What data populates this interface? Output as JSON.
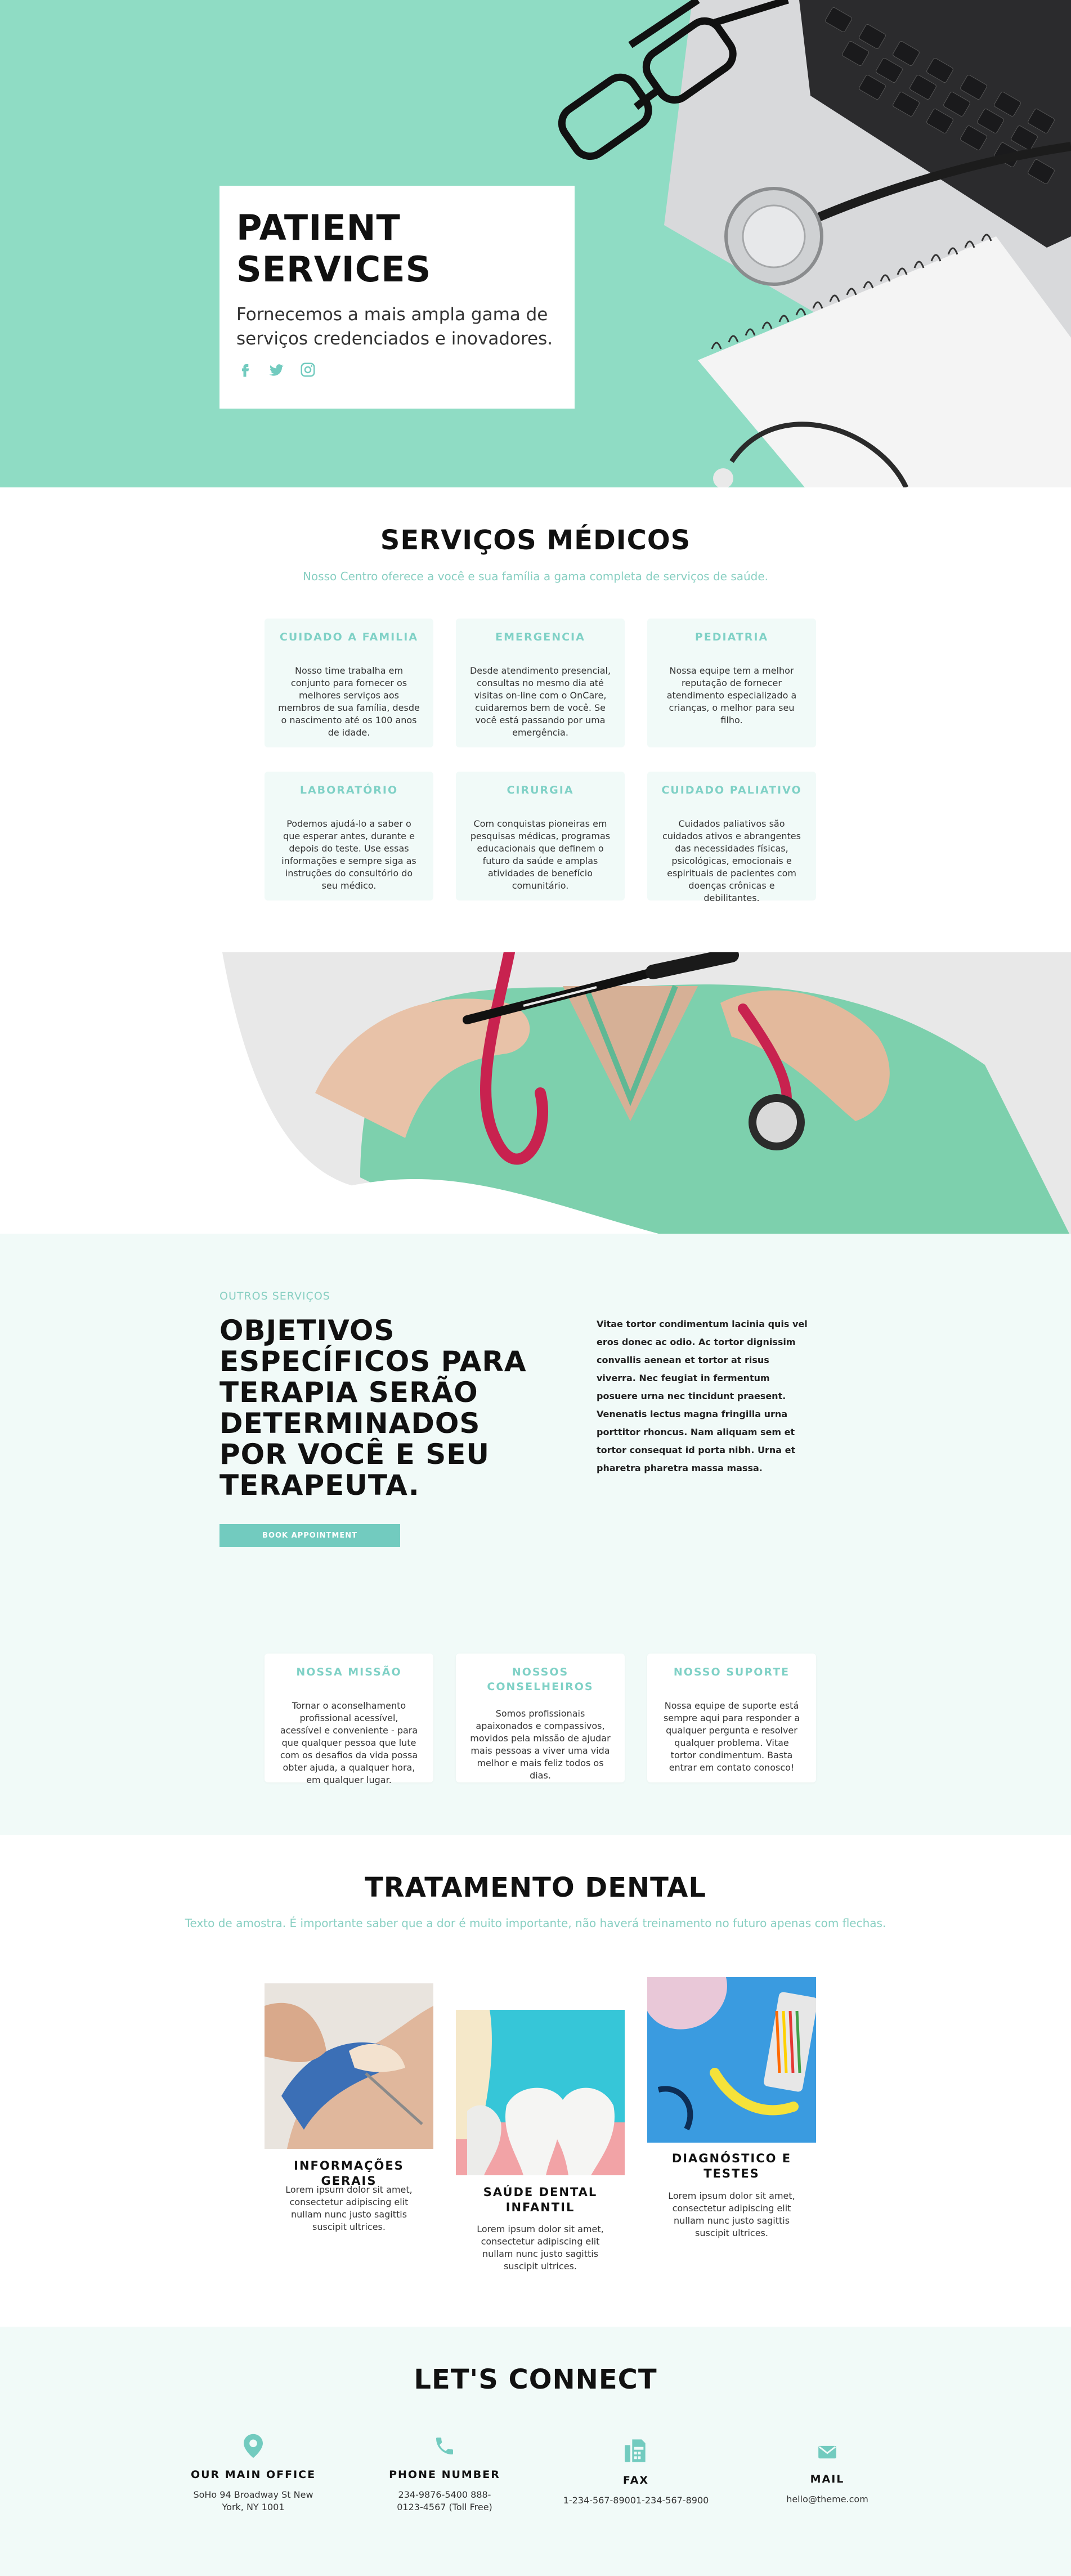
{
  "hero": {
    "title_line1": "PATIENT",
    "title_line2": "SERVICES",
    "subtitle": "Fornecemos a mais ampla gama de serviços credenciados e inovadores.",
    "social_icons": [
      "facebook-icon",
      "twitter-icon",
      "instagram-icon"
    ]
  },
  "services": {
    "title": "SERVIÇOS MÉDICOS",
    "subtitle": "Nosso Centro oferece a você e sua família a gama completa de serviços de saúde.",
    "cards": [
      {
        "title": "CUIDADO A FAMILIA",
        "text": "Nosso time trabalha em conjunto para fornecer os melhores serviços aos membros de sua família, desde o nascimento até os 100 anos de idade."
      },
      {
        "title": "EMERGENCIA",
        "text": "Desde atendimento presencial, consultas no mesmo dia até visitas on-line com o OnCare, cuidaremos bem de você. Se você está passando por uma emergência."
      },
      {
        "title": "PEDIATRIA",
        "text": "Nossa equipe tem a melhor reputação de fornecer atendimento especializado a crianças, o melhor para seu filho."
      },
      {
        "title": "LABORATÓRIO",
        "text": "Podemos ajudá-lo a saber o que esperar antes, durante e depois do teste. Use essas informações e sempre siga as instruções do consultório do seu médico."
      },
      {
        "title": "CIRURGIA",
        "text": "Com conquistas pioneiras em pesquisas médicas, programas educacionais que definem o futuro da saúde e amplas atividades de benefício comunitário."
      },
      {
        "title": "CUIDADO PALIATIVO",
        "text": "Cuidados paliativos são cuidados ativos e abrangentes das necessidades físicas, psicológicas, emocionais e espirituais de pacientes com doenças crônicas e debilitantes."
      }
    ]
  },
  "outros": {
    "label": "OUTROS SERVIÇOS",
    "heading": "OBJETIVOS ESPECÍFICOS PARA TERAPIA SERÃO DETERMINADOS POR VOCÊ E SEU TERAPEUTA.",
    "button_label": "BOOK APPOINTMENT",
    "body": "Vitae tortor condimentum lacinia quis vel eros donec ac odio. Ac tortor dignissim convallis aenean et tortor at risus viverra. Nec feugiat in fermentum posuere urna nec tincidunt praesent. Venenatis lectus magna fringilla urna porttitor rhoncus. Nam aliquam sem et tortor consequat id porta nibh. Urna et pharetra pharetra massa massa.",
    "cards": [
      {
        "title": "NOSSA MISSÃO",
        "text": "Tornar o aconselhamento profissional acessível, acessível e conveniente - para que qualquer pessoa que lute com os desafios da vida possa obter ajuda, a qualquer hora, em qualquer lugar."
      },
      {
        "title": "NOSSOS CONSELHEIROS",
        "text": "Somos profissionais apaixonados e compassivos, movidos pela missão de ajudar mais pessoas a viver uma vida melhor e mais feliz todos os dias."
      },
      {
        "title": "NOSSO SUPORTE",
        "text": "Nossa equipe de suporte está sempre aqui para responder a qualquer pergunta e resolver qualquer problema. Vitae tortor condimentum. Basta entrar em contato conosco!"
      }
    ]
  },
  "dental": {
    "title": "TRATAMENTO DENTAL",
    "subtitle": "Texto de amostra. É importante saber que a dor é muito importante, não haverá treinamento no futuro apenas com flechas.",
    "items": [
      {
        "title": "INFORMAÇÕES GERAIS",
        "text": "Lorem ipsum dolor sit amet, consectetur adipiscing elit nullam nunc justo sagittis suscipit ultrices."
      },
      {
        "title": "SAÚDE DENTAL INFANTIL",
        "text": "Lorem ipsum dolor sit amet, consectetur adipiscing elit nullam nunc justo sagittis suscipit ultrices."
      },
      {
        "title": "DIAGNÓSTICO E TESTES",
        "text": "Lorem ipsum dolor sit amet, consectetur adipiscing elit nullam nunc justo sagittis suscipit ultrices."
      }
    ]
  },
  "connect": {
    "title": "LET'S CONNECT",
    "items": [
      {
        "icon": "location-pin-icon",
        "label": "OUR MAIN OFFICE",
        "value": "SoHo 94 Broadway St New York, NY 1001"
      },
      {
        "icon": "phone-icon",
        "label": "PHONE NUMBER",
        "value": "234-9876-5400 888-0123-4567 (Toll Free)"
      },
      {
        "icon": "fax-icon",
        "label": "FAX",
        "value": "1-234-567-89001-234-567-8900"
      },
      {
        "icon": "mail-icon",
        "label": "MAIL",
        "value": "hello@theme.com"
      }
    ]
  },
  "colors": {
    "accent": "#72cbbf",
    "accent_light": "#88cfc2",
    "hero_bg": "#8fdcc4",
    "section_bg": "#f1faf8"
  }
}
